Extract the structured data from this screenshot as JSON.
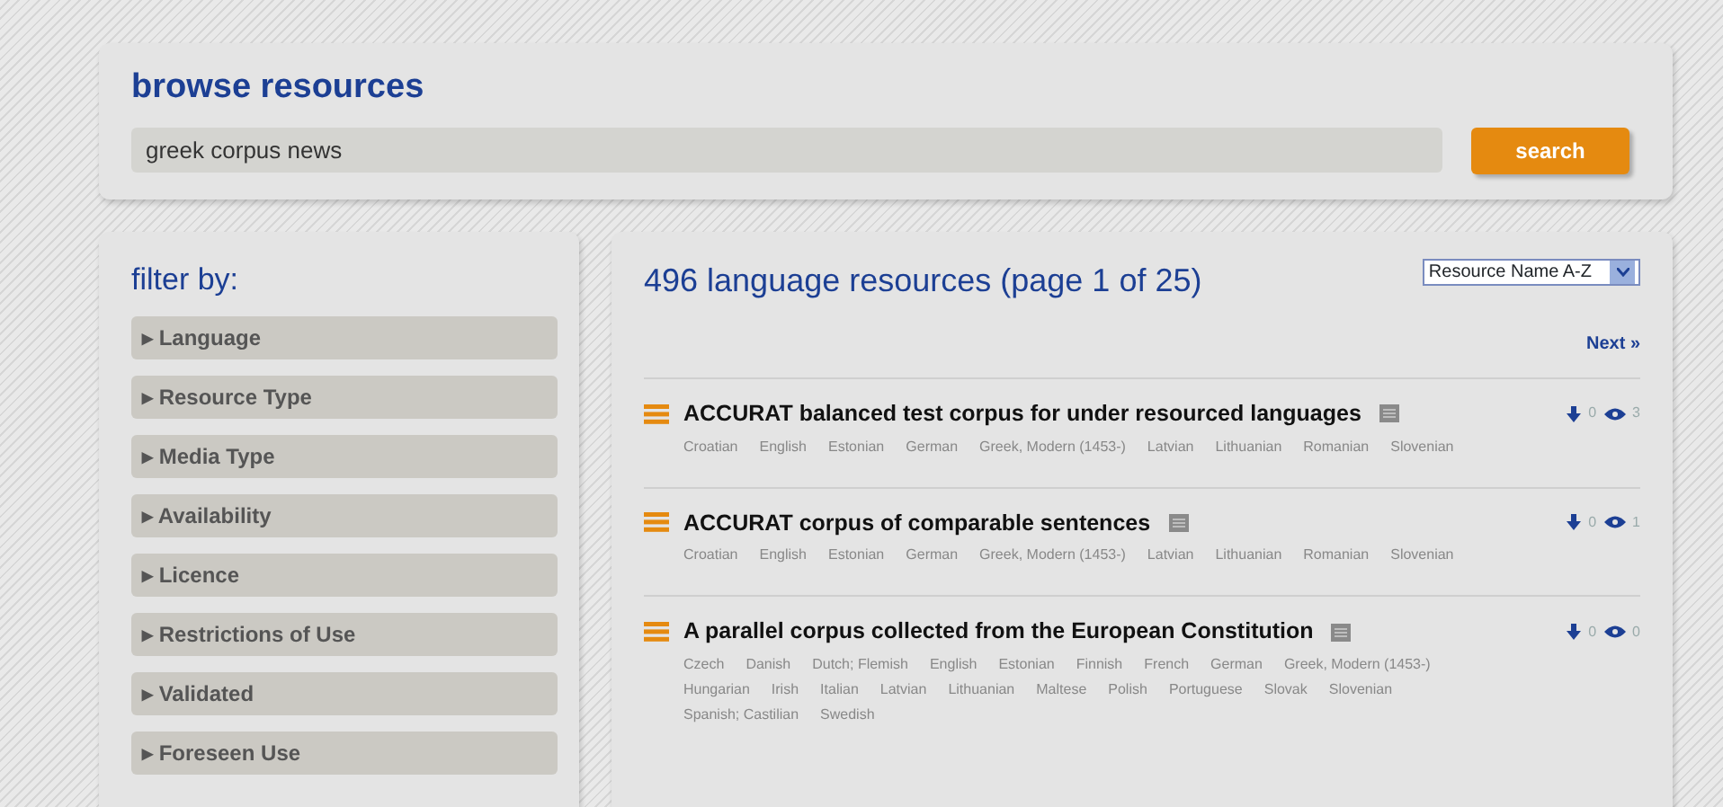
{
  "header": {
    "title": "browse resources",
    "search": {
      "value": "greek corpus news"
    },
    "button": "search"
  },
  "filters": {
    "title": "filter by:",
    "items": [
      {
        "label": "▸ Language"
      },
      {
        "label": "▸ Resource Type"
      },
      {
        "label": "▸ Media Type"
      },
      {
        "label": "▸ Availability"
      },
      {
        "label": "▸ Licence"
      },
      {
        "label": "▸ Restrictions of Use"
      },
      {
        "label": "▸ Validated"
      },
      {
        "label": "▸ Foreseen Use"
      }
    ]
  },
  "results": {
    "heading": "496 language resources (page 1 of 25)",
    "sort": "Resource Name A-Z",
    "next": "Next »",
    "rows": [
      {
        "title": "ACCURAT balanced test corpus for under resourced languages",
        "languages": [
          "Croatian",
          "English",
          "Estonian",
          "German",
          "Greek, Modern (1453-)",
          "Latvian",
          "Lithuanian",
          "Romanian",
          "Slovenian"
        ],
        "downloads": "0",
        "views": "3"
      },
      {
        "title": "ACCURAT corpus of comparable sentences",
        "languages": [
          "Croatian",
          "English",
          "Estonian",
          "German",
          "Greek, Modern (1453-)",
          "Latvian",
          "Lithuanian",
          "Romanian",
          "Slovenian"
        ],
        "downloads": "0",
        "views": "1"
      },
      {
        "title": "A parallel corpus collected from the European Constitution",
        "languages": [
          "Czech",
          "Danish",
          "Dutch; Flemish",
          "English",
          "Estonian",
          "Finnish",
          "French",
          "German",
          "Greek, Modern (1453-)",
          "Hungarian",
          "Irish",
          "Italian",
          "Latvian",
          "Lithuanian",
          "Maltese",
          "Polish",
          "Portuguese",
          "Slovak",
          "Slovenian",
          "Spanish; Castilian",
          "Swedish"
        ],
        "downloads": "0",
        "views": "0"
      }
    ]
  }
}
